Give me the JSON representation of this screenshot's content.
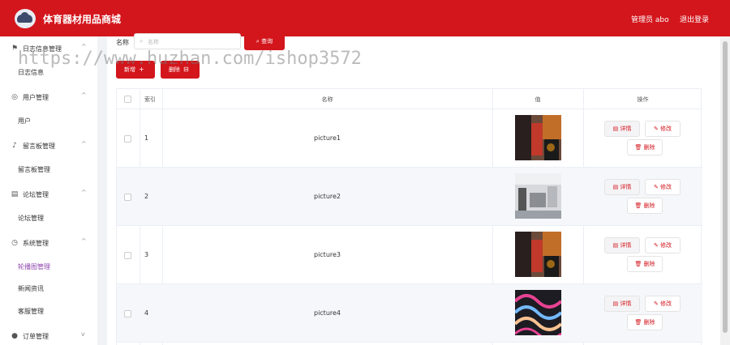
{
  "header": {
    "site_title": "体育器材用品商城",
    "admin_label": "管理员 abo",
    "logout_label": "退出登录"
  },
  "sidebar": {
    "groups": [
      {
        "label": "日志信息管理",
        "icon": "flag-icon",
        "items": [
          "日志信息"
        ]
      },
      {
        "label": "用户管理",
        "icon": "user-circle-icon",
        "items": [
          "用户"
        ]
      },
      {
        "label": "留言板管理",
        "icon": "microphone-icon",
        "items": [
          "留言板管理"
        ]
      },
      {
        "label": "论坛管理",
        "icon": "forum-icon",
        "items": [
          "论坛管理"
        ]
      },
      {
        "label": "系统管理",
        "icon": "clock-icon",
        "items": [
          "轮播图管理",
          "新闻资讯",
          "客服管理"
        ]
      },
      {
        "label": "订单管理",
        "icon": "user-icon",
        "items": []
      }
    ],
    "active_item": "轮播图管理"
  },
  "search": {
    "label": "名称",
    "placeholder": "名称",
    "button_label": "查询"
  },
  "toolbar": {
    "add_label": "新增",
    "delete_label": "删除"
  },
  "table": {
    "columns": [
      "索引",
      "名称",
      "值",
      "操作"
    ],
    "rows": [
      {
        "index": "1",
        "name": "picture1"
      },
      {
        "index": "2",
        "name": "picture2"
      },
      {
        "index": "3",
        "name": "picture3"
      },
      {
        "index": "4",
        "name": "picture4"
      }
    ],
    "actions": {
      "detail": "详情",
      "edit": "修改",
      "delete": "删除"
    }
  },
  "watermark": "https://www.huzhan.com/ishop3572",
  "colors": {
    "brand": "#d3161c",
    "active_menu": "#8e44ad"
  }
}
